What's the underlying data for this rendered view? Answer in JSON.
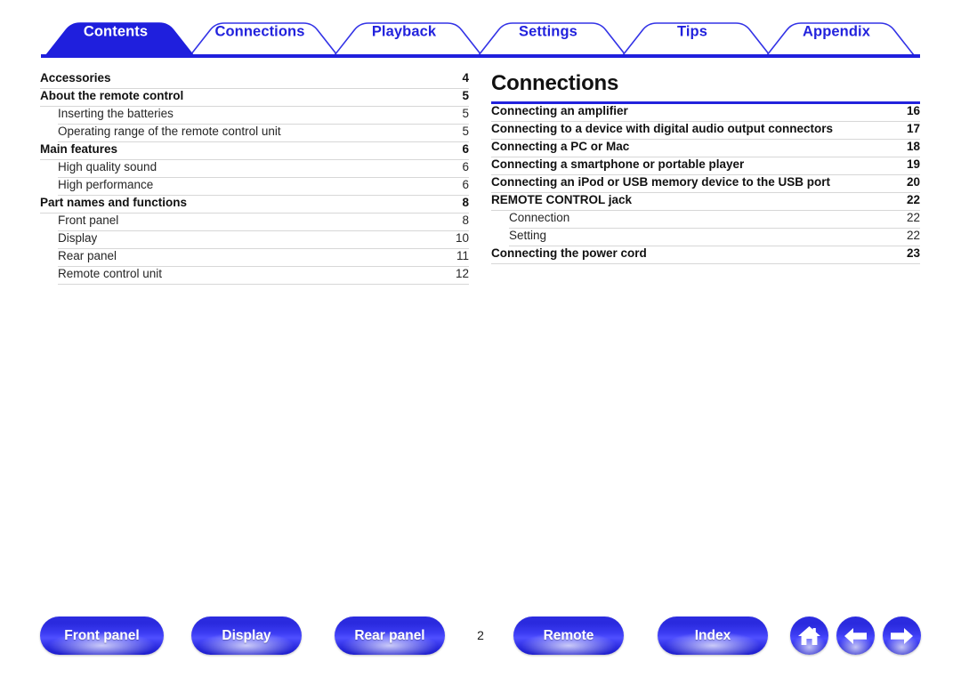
{
  "tabs": [
    {
      "label": "Contents",
      "active": true
    },
    {
      "label": "Connections",
      "active": false
    },
    {
      "label": "Playback",
      "active": false
    },
    {
      "label": "Settings",
      "active": false
    },
    {
      "label": "Tips",
      "active": false
    },
    {
      "label": "Appendix",
      "active": false
    }
  ],
  "columns": {
    "left": {
      "title": "",
      "entries": [
        {
          "label": "Accessories",
          "page": "4",
          "level": 1
        },
        {
          "label": "About the remote control",
          "page": "5",
          "level": 1
        },
        {
          "label": "Inserting the batteries",
          "page": "5",
          "level": 2
        },
        {
          "label": "Operating range of the remote control unit",
          "page": "5",
          "level": 2
        },
        {
          "label": "Main features",
          "page": "6",
          "level": 1
        },
        {
          "label": "High quality sound",
          "page": "6",
          "level": 2
        },
        {
          "label": "High performance",
          "page": "6",
          "level": 2
        },
        {
          "label": "Part names and functions",
          "page": "8",
          "level": 1
        },
        {
          "label": "Front panel",
          "page": "8",
          "level": 2
        },
        {
          "label": "Display",
          "page": "10",
          "level": 2
        },
        {
          "label": "Rear panel",
          "page": "11",
          "level": 2
        },
        {
          "label": "Remote control unit",
          "page": "12",
          "level": 2
        }
      ]
    },
    "right": {
      "title": "Connections",
      "entries": [
        {
          "label": "Connecting an amplifier",
          "page": "16",
          "level": 1
        },
        {
          "label": "Connecting to a device with digital audio output connectors",
          "page": "17",
          "level": 1
        },
        {
          "label": "Connecting a PC or Mac",
          "page": "18",
          "level": 1
        },
        {
          "label": "Connecting a smartphone or portable player",
          "page": "19",
          "level": 1
        },
        {
          "label": "Connecting an iPod or USB memory device to the USB port",
          "page": "20",
          "level": 1
        },
        {
          "label": "REMOTE CONTROL jack",
          "page": "22",
          "level": 1
        },
        {
          "label": "Connection",
          "page": "22",
          "level": 2
        },
        {
          "label": "Setting",
          "page": "22",
          "level": 2
        },
        {
          "label": "Connecting the power cord",
          "page": "23",
          "level": 1
        }
      ]
    }
  },
  "footer": {
    "buttons": [
      {
        "label": "Front panel"
      },
      {
        "label": "Display"
      },
      {
        "label": "Rear panel"
      },
      {
        "label": "Remote"
      },
      {
        "label": "Index"
      }
    ],
    "page_number": "2",
    "icons": [
      {
        "name": "home-icon"
      },
      {
        "name": "arrow-left-icon"
      },
      {
        "name": "arrow-right-icon"
      }
    ]
  },
  "colors": {
    "brand_blue": "#2222dd",
    "active_tab_bg": "#1f1fdd",
    "tab_text": "#2222dd",
    "rule": "#d7d7d7"
  }
}
